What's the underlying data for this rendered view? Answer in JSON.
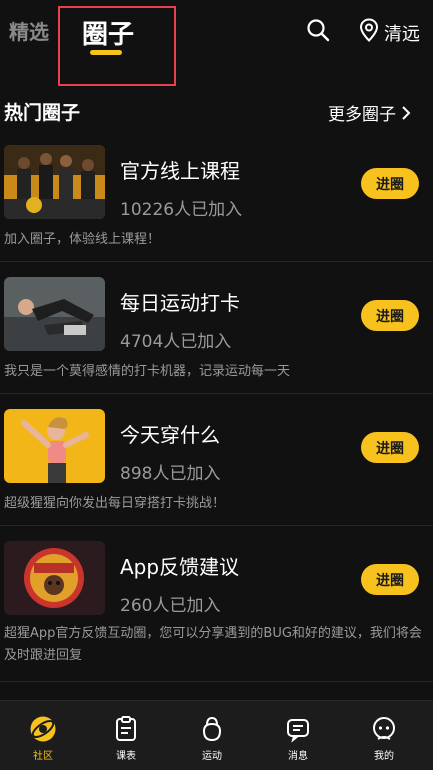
{
  "header": {
    "tab_featured": "精选",
    "tab_circles": "圈子",
    "location": "清远",
    "accent_color": "#f7c21e"
  },
  "section": {
    "title": "热门圈子",
    "more": "更多圈子"
  },
  "circles": [
    {
      "name": "官方线上课程",
      "count": "10226人已加入",
      "join": "进圈",
      "desc": "加入圈子，体验线上课程！",
      "thumb_icon": "fitness-group-photo"
    },
    {
      "name": "每日运动打卡",
      "count": "4704人已加入",
      "join": "进圈",
      "desc": "我只是一个莫得感情的打卡机器，记录运动每一天",
      "thumb_icon": "stretching-photo"
    },
    {
      "name": "今天穿什么",
      "count": "898人已加入",
      "join": "进圈",
      "desc": "超级猩猩向你发出每日穿搭打卡挑战！",
      "thumb_icon": "dancer-photo"
    },
    {
      "name": "App反馈建议",
      "count": "260人已加入",
      "join": "进圈",
      "desc": "超猩App官方反馈互动圈，您可以分享遇到的BUG和好的建议，我们将会及时跟进回复",
      "thumb_icon": "gorilla-badge-photo"
    }
  ],
  "nav": {
    "community": "社区",
    "schedule": "课表",
    "sports": "运动",
    "messages": "消息",
    "mine": "我的"
  }
}
